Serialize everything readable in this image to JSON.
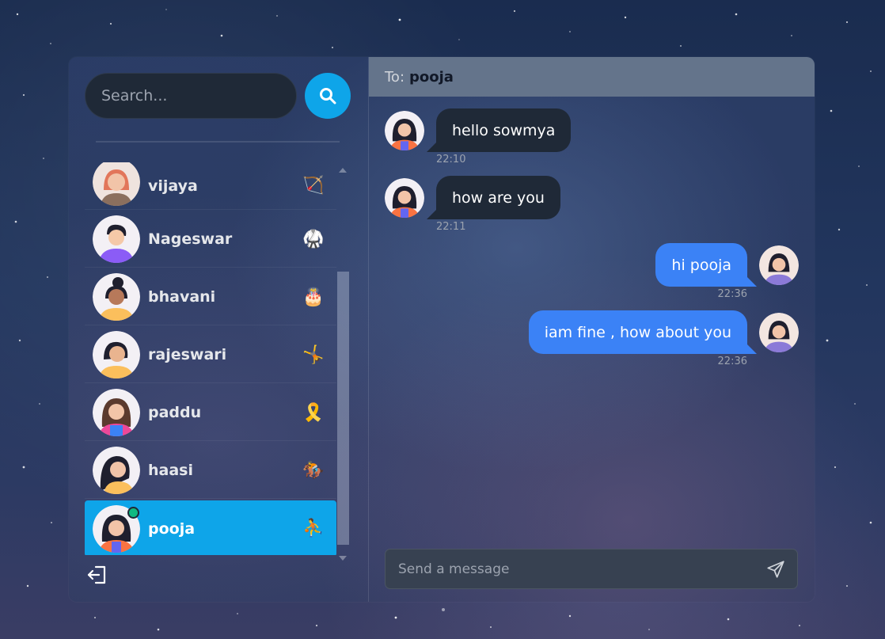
{
  "search": {
    "placeholder": "Search..."
  },
  "contacts": [
    {
      "name": "vijaya",
      "status_emoji": "🏹"
    },
    {
      "name": "Nageswar",
      "status_emoji": "🥋"
    },
    {
      "name": "bhavani",
      "status_emoji": "🎂"
    },
    {
      "name": "rajeswari",
      "status_emoji": "🤸"
    },
    {
      "name": "paddu",
      "status_emoji": "🎗️"
    },
    {
      "name": "haasi",
      "status_emoji": "🏇"
    },
    {
      "name": "pooja",
      "status_emoji": "⛹️"
    }
  ],
  "active_contact": "pooja",
  "chat": {
    "to_label": "To:",
    "to_name": "pooja",
    "messages": [
      {
        "text": "hello sowmya",
        "time": "22:10",
        "direction": "incoming"
      },
      {
        "text": "how are you",
        "time": "22:11",
        "direction": "incoming"
      },
      {
        "text": "hi pooja",
        "time": "22:36",
        "direction": "outgoing"
      },
      {
        "text": "iam fine , how about you",
        "time": "22:36",
        "direction": "outgoing"
      }
    ],
    "composer_placeholder": "Send a message"
  },
  "colors": {
    "accent": "#0ea5e9",
    "outgoing_bubble": "#3b82f6",
    "incoming_bubble": "#1f2937",
    "header": "#64748b",
    "online": "#10b981"
  }
}
